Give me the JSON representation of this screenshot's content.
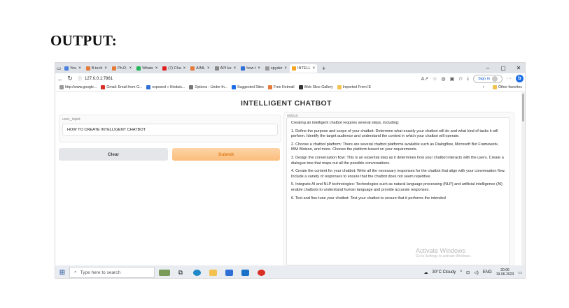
{
  "document": {
    "heading": "OUTPUT:"
  },
  "browser": {
    "tabs": [
      {
        "title": "You",
        "color": "#4a7fe0"
      },
      {
        "title": "B.tech",
        "color": "#e57a3b"
      },
      {
        "title": "Ph.D.",
        "color": "#e57a3b"
      },
      {
        "title": "Whats",
        "color": "#25b35a"
      },
      {
        "title": "(7) Cha",
        "color": "#e02020"
      },
      {
        "title": "AIML",
        "color": "#e57a3b"
      },
      {
        "title": "API ke",
        "color": "#888888"
      },
      {
        "title": "how t",
        "color": "#2f6fd6"
      },
      {
        "title": "spyder",
        "color": "#999999"
      },
      {
        "title": "INTELL",
        "color": "#f5a623",
        "active": true
      }
    ],
    "url": "127.0.0.1:7861",
    "signin_label": "Sign in",
    "favorites": [
      {
        "label": "http://www.google...",
        "color": "#999999"
      },
      {
        "label": "Gmail: Email from G...",
        "color": "#d93025"
      },
      {
        "label": "exposed « Hinduis...",
        "color": "#2f6fd6"
      },
      {
        "label": "Options - Under th...",
        "color": "#777777"
      },
      {
        "label": "Suggested Sites",
        "color": "#1b6ee6"
      },
      {
        "label": "Free Hotmail",
        "color": "#e57a3b"
      },
      {
        "label": "Web Slice Gallery",
        "color": "#333333"
      },
      {
        "label": "Imported From IE",
        "color": "#f2c14e"
      }
    ],
    "other_favorites": "Other favorites"
  },
  "app": {
    "title": "INTELLIGENT CHATBOT",
    "input_label": "user_input",
    "input_value": "HOW TO CREATE INTELLIGENT CHATBOT",
    "clear_label": "Clear",
    "submit_label": "Submit",
    "output_label": "output",
    "output_paragraphs": [
      "Creating an intelligent chatbot requires several steps, including:",
      "1. Define the purpose and scope of your chatbot: Determine what exactly your chatbot will do and what kind of tasks it will perform. Identify the target audience and understand the context in which your chatbot will operate.",
      "2. Choose a chatbot platform: There are several chatbot platforms available such as Dialogflow, Microsoft Bot Framework, IBM Watson, and more. Choose the platform based on your requirements.",
      "3. Design the conversation flow: This is an essential step as it determines how your chatbot interacts with the users. Create a dialogue tree that maps out all the possible conversations.",
      "4. Create the content for your chatbot: Write all the necessary responses for the chatbot that align with your conversation flow. Include a variety of responses to ensure that the chatbot does not seem repetitive.",
      "5. Integrate AI and NLP technologies: Technologies such as natural language processing (NLP) and artificial intelligence (AI) enable chatbots to understand human language and provide accurate responses.",
      "6. Test and fine-tune your chatbot: Test your chatbot to ensure that it performs the intended"
    ],
    "watermark_title": "Activate Windows",
    "watermark_sub": "Go to Settings to activate Windows."
  },
  "taskbar": {
    "search_placeholder": "Type here to search",
    "weather": "30°C  Cloudy",
    "lang": "ENG",
    "time": "20:06",
    "date": "19-06-2023"
  }
}
